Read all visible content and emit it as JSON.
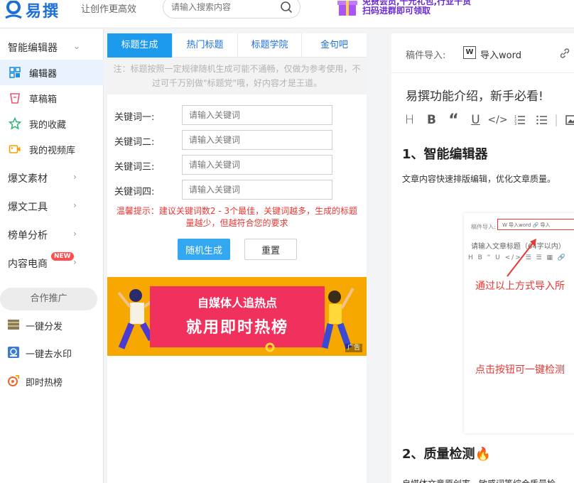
{
  "header": {
    "logo_text": "易撰",
    "slogan": "让创作更高效",
    "search_placeholder": "请输入搜索内容",
    "promo_line1": "免费会员,千元礼包,行业干货",
    "promo_line2": "扫码进群即可领取"
  },
  "sidebar": {
    "editor_group": "智能编辑器",
    "items": [
      {
        "label": "编辑器",
        "icon": "grid-icon"
      },
      {
        "label": "草稿箱",
        "icon": "draft-icon"
      },
      {
        "label": "我的收藏",
        "icon": "star-icon"
      },
      {
        "label": "我的视频库",
        "icon": "video-icon"
      }
    ],
    "groups": [
      "爆文素材",
      "爆文工具",
      "榜单分析",
      "内容电商"
    ],
    "new_badge": "NEW",
    "coop": "合作推广",
    "tools": [
      {
        "label": "一键分发",
        "icon": "distribute-icon"
      },
      {
        "label": "一键去水印",
        "icon": "watermark-icon"
      },
      {
        "label": "即时热榜",
        "icon": "hot-icon"
      }
    ]
  },
  "title_panel": {
    "tabs": [
      "标题生成",
      "热门标题",
      "标题学院",
      "金句吧"
    ],
    "active_tab": 0,
    "notice": "注：标题按照一定规律随机生成可能不通畅，仅做为参考使用，不过可千万别做\"标题党\"哦，好内容才是王道。",
    "keywords": [
      {
        "label": "关键词一:",
        "placeholder": "请输入关键词"
      },
      {
        "label": "关键词二:",
        "placeholder": "请输入关键词"
      },
      {
        "label": "关键词三:",
        "placeholder": "请输入关键词"
      },
      {
        "label": "关键词四:",
        "placeholder": "请输入关键词"
      }
    ],
    "tip": "温馨提示：建议关键词数2 - 3个最佳，关键词越多，生成的标题量越少，但越符合您的要求",
    "generate_btn": "随机生成",
    "reset_btn": "重置",
    "banner_line1": "自媒体人追热点",
    "banner_line2": "就用即时热榜",
    "ad_tag": "广告"
  },
  "editor": {
    "import_label": "稿件导入:",
    "import_word": "导入word",
    "article_title": "易撰功能介绍，新手必看!",
    "toolbar": [
      "H",
      "B",
      "“",
      "U",
      "</>",
      "ol",
      "ul",
      "img"
    ],
    "h1": "1、智能编辑器",
    "para1": "文章内容快速排版编辑，优化文章质量。",
    "shot_import": "稿件导入:",
    "shot_word": "W 导入word     🔗 导入",
    "shot_title": "请输入文章标题（64字以内）",
    "shot_toolbar": "H B “ U </> ☰ ☰ ▦ 🔗",
    "shot_red1": "通过以上方式导入所",
    "shot_red2": "点击按钮可一键检测",
    "h2": "2、质量检测🔥",
    "para2": "自媒体文章原创率、敏感词等综合质量检"
  }
}
